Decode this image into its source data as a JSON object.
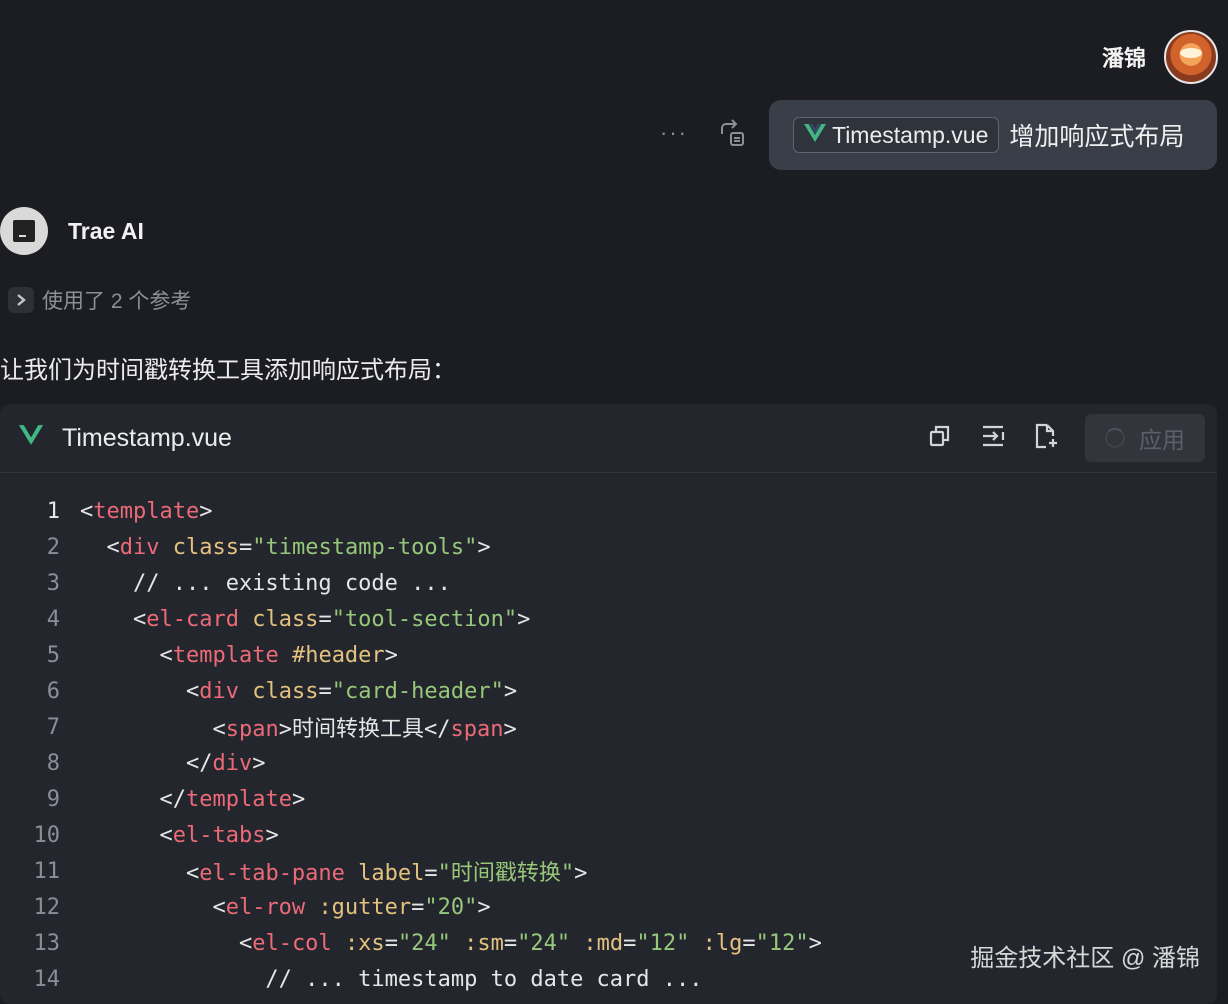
{
  "user": {
    "name": "潘锦"
  },
  "message": {
    "more_label": "···",
    "file_chip": "Timestamp.vue",
    "text": "增加响应式布局"
  },
  "assistant": {
    "name": "Trae AI",
    "references": "使用了 2 个参考",
    "intro": "让我们为时间戳转换工具添加响应式布局："
  },
  "code_block": {
    "filename": "Timestamp.vue",
    "apply_label": "应用",
    "lines": [
      {
        "n": "1",
        "tokens": [
          [
            "punct",
            "<"
          ],
          [
            "tag",
            "template"
          ],
          [
            "punct",
            ">"
          ]
        ]
      },
      {
        "n": "2",
        "tokens": [
          [
            "txt",
            "  "
          ],
          [
            "punct",
            "<"
          ],
          [
            "tag",
            "div"
          ],
          [
            "txt",
            " "
          ],
          [
            "attr",
            "class"
          ],
          [
            "punct",
            "="
          ],
          [
            "str",
            "\"timestamp-tools\""
          ],
          [
            "punct",
            ">"
          ]
        ]
      },
      {
        "n": "3",
        "tokens": [
          [
            "txt",
            "    // ... existing code ..."
          ]
        ]
      },
      {
        "n": "4",
        "tokens": [
          [
            "txt",
            "    "
          ],
          [
            "punct",
            "<"
          ],
          [
            "tag",
            "el-card"
          ],
          [
            "txt",
            " "
          ],
          [
            "attr",
            "class"
          ],
          [
            "punct",
            "="
          ],
          [
            "str",
            "\"tool-section\""
          ],
          [
            "punct",
            ">"
          ]
        ]
      },
      {
        "n": "5",
        "tokens": [
          [
            "txt",
            "      "
          ],
          [
            "punct",
            "<"
          ],
          [
            "tag",
            "template"
          ],
          [
            "txt",
            " "
          ],
          [
            "attr",
            "#header"
          ],
          [
            "punct",
            ">"
          ]
        ]
      },
      {
        "n": "6",
        "tokens": [
          [
            "txt",
            "        "
          ],
          [
            "punct",
            "<"
          ],
          [
            "tag",
            "div"
          ],
          [
            "txt",
            " "
          ],
          [
            "attr",
            "class"
          ],
          [
            "punct",
            "="
          ],
          [
            "str",
            "\"card-header\""
          ],
          [
            "punct",
            ">"
          ]
        ]
      },
      {
        "n": "7",
        "tokens": [
          [
            "txt",
            "          "
          ],
          [
            "punct",
            "<"
          ],
          [
            "tag",
            "span"
          ],
          [
            "punct",
            ">"
          ],
          [
            "txt",
            "时间转换工具"
          ],
          [
            "punct",
            "</"
          ],
          [
            "tag",
            "span"
          ],
          [
            "punct",
            ">"
          ]
        ]
      },
      {
        "n": "8",
        "tokens": [
          [
            "txt",
            "        "
          ],
          [
            "punct",
            "</"
          ],
          [
            "tag",
            "div"
          ],
          [
            "punct",
            ">"
          ]
        ]
      },
      {
        "n": "9",
        "tokens": [
          [
            "txt",
            "      "
          ],
          [
            "punct",
            "</"
          ],
          [
            "tag",
            "template"
          ],
          [
            "punct",
            ">"
          ]
        ]
      },
      {
        "n": "10",
        "tokens": [
          [
            "txt",
            "      "
          ],
          [
            "punct",
            "<"
          ],
          [
            "tag",
            "el-tabs"
          ],
          [
            "punct",
            ">"
          ]
        ]
      },
      {
        "n": "11",
        "tokens": [
          [
            "txt",
            "        "
          ],
          [
            "punct",
            "<"
          ],
          [
            "tag",
            "el-tab-pane"
          ],
          [
            "txt",
            " "
          ],
          [
            "attr",
            "label"
          ],
          [
            "punct",
            "="
          ],
          [
            "str",
            "\"时间戳转换\""
          ],
          [
            "punct",
            ">"
          ]
        ]
      },
      {
        "n": "12",
        "tokens": [
          [
            "txt",
            "          "
          ],
          [
            "punct",
            "<"
          ],
          [
            "tag",
            "el-row"
          ],
          [
            "txt",
            " "
          ],
          [
            "attr",
            ":gutter"
          ],
          [
            "punct",
            "="
          ],
          [
            "str",
            "\"20\""
          ],
          [
            "punct",
            ">"
          ]
        ]
      },
      {
        "n": "13",
        "tokens": [
          [
            "txt",
            "            "
          ],
          [
            "punct",
            "<"
          ],
          [
            "tag",
            "el-col"
          ],
          [
            "txt",
            " "
          ],
          [
            "attr",
            ":xs"
          ],
          [
            "punct",
            "="
          ],
          [
            "str",
            "\"24\""
          ],
          [
            "txt",
            " "
          ],
          [
            "attr",
            ":sm"
          ],
          [
            "punct",
            "="
          ],
          [
            "str",
            "\"24\""
          ],
          [
            "txt",
            " "
          ],
          [
            "attr",
            ":md"
          ],
          [
            "punct",
            "="
          ],
          [
            "str",
            "\"12\""
          ],
          [
            "txt",
            " "
          ],
          [
            "attr",
            ":lg"
          ],
          [
            "punct",
            "="
          ],
          [
            "str",
            "\"12\""
          ],
          [
            "punct",
            ">"
          ]
        ]
      },
      {
        "n": "14",
        "tokens": [
          [
            "txt",
            "              // ... timestamp to date card ..."
          ]
        ]
      }
    ]
  },
  "watermark": "掘金技术社区 @ 潘锦",
  "colors": {
    "background": "#1c1d22",
    "bubble": "#3a3e48",
    "vue_green": "#41b883",
    "tag": "#ec6a78",
    "attr": "#e3c17f",
    "string": "#97c77a"
  },
  "icons": [
    "resend-icon",
    "vue-icon",
    "copy-icon",
    "insert-icon",
    "new-file-icon",
    "chevron-right-icon"
  ]
}
